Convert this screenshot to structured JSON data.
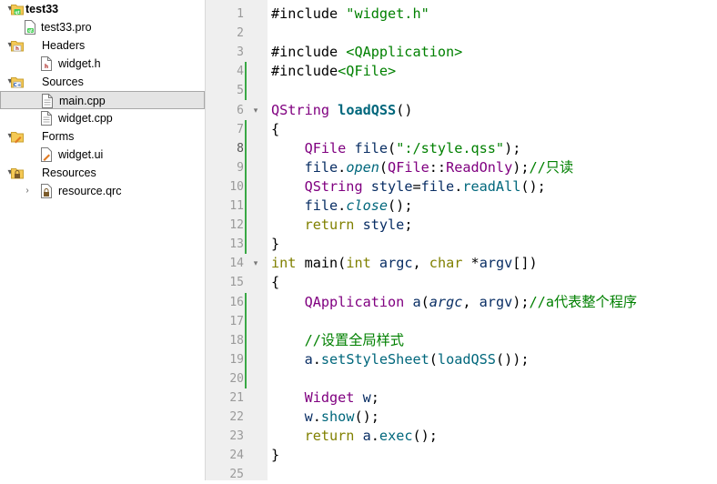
{
  "project_tree": {
    "items": [
      {
        "label": "test33",
        "icon": "qt-project-icon",
        "expander": "▾",
        "bold": true
      },
      {
        "label": "test33.pro",
        "icon": "pro-file-icon",
        "expander": ""
      },
      {
        "label": "Headers",
        "icon": "folder-h-icon",
        "expander": "▾"
      },
      {
        "label": "widget.h",
        "icon": "header-file-icon",
        "expander": ""
      },
      {
        "label": "Sources",
        "icon": "folder-cpp-icon",
        "expander": "▾"
      },
      {
        "label": "main.cpp",
        "icon": "cpp-file-icon",
        "expander": "",
        "selected": true
      },
      {
        "label": "widget.cpp",
        "icon": "cpp-file-icon",
        "expander": ""
      },
      {
        "label": "Forms",
        "icon": "folder-ui-icon",
        "expander": "▾"
      },
      {
        "label": "widget.ui",
        "icon": "ui-file-icon",
        "expander": ""
      },
      {
        "label": "Resources",
        "icon": "folder-res-icon",
        "expander": "▾"
      },
      {
        "label": "resource.qrc",
        "icon": "qrc-file-icon",
        "expander": "›"
      }
    ]
  },
  "editor": {
    "current_line": 8,
    "line_numbers": [
      "1",
      "2",
      "3",
      "4",
      "5",
      "6",
      "7",
      "8",
      "9",
      "10",
      "11",
      "12",
      "13",
      "14",
      "15",
      "16",
      "17",
      "18",
      "19",
      "20",
      "21",
      "22",
      "23",
      "24",
      "25"
    ],
    "fold_markers": [
      "▾",
      "▾"
    ],
    "lines": [
      [
        {
          "t": "#include ",
          "c": "plain"
        },
        {
          "t": "\"widget.h\"",
          "c": "str"
        }
      ],
      [],
      [
        {
          "t": "#include ",
          "c": "plain"
        },
        {
          "t": "<QApplication>",
          "c": "incs"
        }
      ],
      [
        {
          "t": "#include",
          "c": "plain"
        },
        {
          "t": "<QFile>",
          "c": "incs"
        }
      ],
      [],
      [
        {
          "t": "QString",
          "c": "type"
        },
        {
          "t": " ",
          "c": "plain"
        },
        {
          "t": "loadQSS",
          "c": "fnb"
        },
        {
          "t": "()",
          "c": "plain"
        }
      ],
      [
        {
          "t": "{",
          "c": "plain"
        }
      ],
      [
        {
          "t": "    ",
          "c": "plain"
        },
        {
          "t": "QFile",
          "c": "type"
        },
        {
          "t": " ",
          "c": "plain"
        },
        {
          "t": "file",
          "c": "var"
        },
        {
          "t": "(",
          "c": "plain"
        },
        {
          "t": "\":/style.qss\"",
          "c": "str"
        },
        {
          "t": ");",
          "c": "plain"
        }
      ],
      [
        {
          "t": "    ",
          "c": "plain"
        },
        {
          "t": "file",
          "c": "var"
        },
        {
          "t": ".",
          "c": "plain"
        },
        {
          "t": "open",
          "c": "fni"
        },
        {
          "t": "(",
          "c": "plain"
        },
        {
          "t": "QFile",
          "c": "type"
        },
        {
          "t": "::",
          "c": "plain"
        },
        {
          "t": "ReadOnly",
          "c": "enm"
        },
        {
          "t": ");",
          "c": "plain"
        },
        {
          "t": "//只读",
          "c": "cmt"
        }
      ],
      [
        {
          "t": "    ",
          "c": "plain"
        },
        {
          "t": "QString",
          "c": "type"
        },
        {
          "t": " ",
          "c": "plain"
        },
        {
          "t": "style",
          "c": "var"
        },
        {
          "t": "=",
          "c": "plain"
        },
        {
          "t": "file",
          "c": "var"
        },
        {
          "t": ".",
          "c": "plain"
        },
        {
          "t": "readAll",
          "c": "fn"
        },
        {
          "t": "();",
          "c": "plain"
        }
      ],
      [
        {
          "t": "    ",
          "c": "plain"
        },
        {
          "t": "file",
          "c": "var"
        },
        {
          "t": ".",
          "c": "plain"
        },
        {
          "t": "close",
          "c": "fni"
        },
        {
          "t": "();",
          "c": "plain"
        }
      ],
      [
        {
          "t": "    ",
          "c": "plain"
        },
        {
          "t": "return",
          "c": "kw"
        },
        {
          "t": " ",
          "c": "plain"
        },
        {
          "t": "style",
          "c": "var"
        },
        {
          "t": ";",
          "c": "plain"
        }
      ],
      [
        {
          "t": "}",
          "c": "plain"
        }
      ],
      [
        {
          "t": "int",
          "c": "kw"
        },
        {
          "t": " ",
          "c": "plain"
        },
        {
          "t": "main",
          "c": "plain"
        },
        {
          "t": "(",
          "c": "plain"
        },
        {
          "t": "int",
          "c": "kw"
        },
        {
          "t": " ",
          "c": "plain"
        },
        {
          "t": "argc",
          "c": "var"
        },
        {
          "t": ", ",
          "c": "plain"
        },
        {
          "t": "char",
          "c": "kw"
        },
        {
          "t": " ",
          "c": "plain"
        },
        {
          "t": "*",
          "c": "plain"
        },
        {
          "t": "argv",
          "c": "var"
        },
        {
          "t": "[])",
          "c": "plain"
        }
      ],
      [
        {
          "t": "{",
          "c": "plain"
        }
      ],
      [
        {
          "t": "    ",
          "c": "plain"
        },
        {
          "t": "QApplication",
          "c": "type"
        },
        {
          "t": " ",
          "c": "plain"
        },
        {
          "t": "a",
          "c": "var"
        },
        {
          "t": "(",
          "c": "plain"
        },
        {
          "t": "argc",
          "c": "par"
        },
        {
          "t": ", ",
          "c": "plain"
        },
        {
          "t": "argv",
          "c": "var"
        },
        {
          "t": ");",
          "c": "plain"
        },
        {
          "t": "//a代表整个程序",
          "c": "cmt"
        }
      ],
      [],
      [
        {
          "t": "    ",
          "c": "plain"
        },
        {
          "t": "//设置全局样式",
          "c": "cmt"
        }
      ],
      [
        {
          "t": "    ",
          "c": "plain"
        },
        {
          "t": "a",
          "c": "var"
        },
        {
          "t": ".",
          "c": "plain"
        },
        {
          "t": "setStyleSheet",
          "c": "fn"
        },
        {
          "t": "(",
          "c": "plain"
        },
        {
          "t": "loadQSS",
          "c": "fn"
        },
        {
          "t": "());",
          "c": "plain"
        }
      ],
      [],
      [
        {
          "t": "    ",
          "c": "plain"
        },
        {
          "t": "Widget",
          "c": "type"
        },
        {
          "t": " ",
          "c": "plain"
        },
        {
          "t": "w",
          "c": "var"
        },
        {
          "t": ";",
          "c": "plain"
        }
      ],
      [
        {
          "t": "    ",
          "c": "plain"
        },
        {
          "t": "w",
          "c": "var"
        },
        {
          "t": ".",
          "c": "plain"
        },
        {
          "t": "show",
          "c": "fn"
        },
        {
          "t": "();",
          "c": "plain"
        }
      ],
      [
        {
          "t": "    ",
          "c": "plain"
        },
        {
          "t": "return",
          "c": "kw"
        },
        {
          "t": " ",
          "c": "plain"
        },
        {
          "t": "a",
          "c": "var"
        },
        {
          "t": ".",
          "c": "plain"
        },
        {
          "t": "exec",
          "c": "fn"
        },
        {
          "t": "();",
          "c": "plain"
        }
      ],
      [
        {
          "t": "}",
          "c": "plain"
        }
      ],
      []
    ]
  },
  "colors": {
    "modified_marker": "#39a845",
    "selection_bg": "#e4e4e4",
    "gutter_bg": "#efefef",
    "keyword": "#808000",
    "type": "#800080",
    "string": "#008000",
    "function": "#00677c"
  }
}
